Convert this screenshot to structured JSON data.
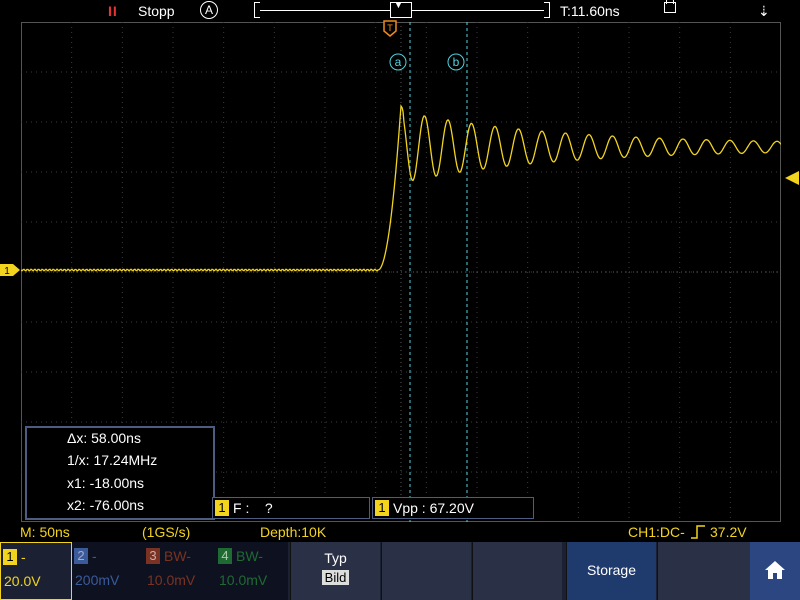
{
  "topbar": {
    "pause_icon": "II",
    "run_state": "Stopp",
    "acq_mode": "A",
    "trigger_marker": "T",
    "trigger_time": "T:11.60ns"
  },
  "plot": {
    "cursor_a_label": "a",
    "cursor_b_label": "b",
    "ch1_marker": "1",
    "grid_divisions": {
      "x": 15,
      "y": 10
    },
    "trace_color": "#f2d41f",
    "cursor_color": "#4fd4e0",
    "grid_color": "#3c3c3c"
  },
  "cursor_readout": {
    "delta_x": "Δx: 58.00ns",
    "inv_x": "1/x: 17.24MHz",
    "x1": "x1: -18.00ns",
    "x2": "x2: -76.00ns"
  },
  "measure": {
    "freq_ch": "1",
    "freq_text": "F :    ?",
    "vpp_ch": "1",
    "vpp_text": "Vpp : 67.20V"
  },
  "status": {
    "timebase": "M: 50ns",
    "sample_rate": "(1GS/s)",
    "depth": "Depth:10K",
    "trigger_info": "CH1:DC-",
    "trigger_level": "37.2V"
  },
  "channels": [
    {
      "num": "1",
      "tag": "-",
      "value": "20.0V",
      "color": "#f2d41f",
      "active": true
    },
    {
      "num": "2",
      "tag": "-",
      "value": "200mV",
      "color": "#3a7bd5",
      "active": false
    },
    {
      "num": "3",
      "tag": "BW-",
      "value": "10.0mV",
      "color": "#d24a2c",
      "active": false
    },
    {
      "num": "4",
      "tag": "BW-",
      "value": "10.0mV",
      "color": "#2eae4b",
      "active": false
    }
  ],
  "menu": {
    "type_label": "Typ",
    "type_value": "Bild",
    "storage_label": "Storage",
    "home_icon": "home-icon"
  }
}
